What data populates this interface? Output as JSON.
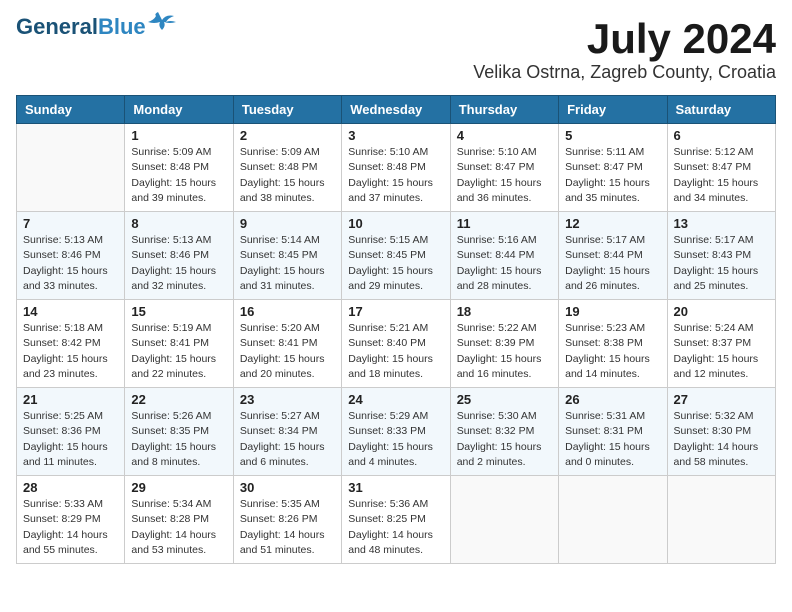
{
  "header": {
    "logo_line1": "General",
    "logo_line2": "Blue",
    "month": "July 2024",
    "location": "Velika Ostrna, Zagreb County, Croatia"
  },
  "weekdays": [
    "Sunday",
    "Monday",
    "Tuesday",
    "Wednesday",
    "Thursday",
    "Friday",
    "Saturday"
  ],
  "weeks": [
    [
      {
        "day": "",
        "sunrise": "",
        "sunset": "",
        "daylight": ""
      },
      {
        "day": "1",
        "sunrise": "Sunrise: 5:09 AM",
        "sunset": "Sunset: 8:48 PM",
        "daylight": "Daylight: 15 hours and 39 minutes."
      },
      {
        "day": "2",
        "sunrise": "Sunrise: 5:09 AM",
        "sunset": "Sunset: 8:48 PM",
        "daylight": "Daylight: 15 hours and 38 minutes."
      },
      {
        "day": "3",
        "sunrise": "Sunrise: 5:10 AM",
        "sunset": "Sunset: 8:48 PM",
        "daylight": "Daylight: 15 hours and 37 minutes."
      },
      {
        "day": "4",
        "sunrise": "Sunrise: 5:10 AM",
        "sunset": "Sunset: 8:47 PM",
        "daylight": "Daylight: 15 hours and 36 minutes."
      },
      {
        "day": "5",
        "sunrise": "Sunrise: 5:11 AM",
        "sunset": "Sunset: 8:47 PM",
        "daylight": "Daylight: 15 hours and 35 minutes."
      },
      {
        "day": "6",
        "sunrise": "Sunrise: 5:12 AM",
        "sunset": "Sunset: 8:47 PM",
        "daylight": "Daylight: 15 hours and 34 minutes."
      }
    ],
    [
      {
        "day": "7",
        "sunrise": "Sunrise: 5:13 AM",
        "sunset": "Sunset: 8:46 PM",
        "daylight": "Daylight: 15 hours and 33 minutes."
      },
      {
        "day": "8",
        "sunrise": "Sunrise: 5:13 AM",
        "sunset": "Sunset: 8:46 PM",
        "daylight": "Daylight: 15 hours and 32 minutes."
      },
      {
        "day": "9",
        "sunrise": "Sunrise: 5:14 AM",
        "sunset": "Sunset: 8:45 PM",
        "daylight": "Daylight: 15 hours and 31 minutes."
      },
      {
        "day": "10",
        "sunrise": "Sunrise: 5:15 AM",
        "sunset": "Sunset: 8:45 PM",
        "daylight": "Daylight: 15 hours and 29 minutes."
      },
      {
        "day": "11",
        "sunrise": "Sunrise: 5:16 AM",
        "sunset": "Sunset: 8:44 PM",
        "daylight": "Daylight: 15 hours and 28 minutes."
      },
      {
        "day": "12",
        "sunrise": "Sunrise: 5:17 AM",
        "sunset": "Sunset: 8:44 PM",
        "daylight": "Daylight: 15 hours and 26 minutes."
      },
      {
        "day": "13",
        "sunrise": "Sunrise: 5:17 AM",
        "sunset": "Sunset: 8:43 PM",
        "daylight": "Daylight: 15 hours and 25 minutes."
      }
    ],
    [
      {
        "day": "14",
        "sunrise": "Sunrise: 5:18 AM",
        "sunset": "Sunset: 8:42 PM",
        "daylight": "Daylight: 15 hours and 23 minutes."
      },
      {
        "day": "15",
        "sunrise": "Sunrise: 5:19 AM",
        "sunset": "Sunset: 8:41 PM",
        "daylight": "Daylight: 15 hours and 22 minutes."
      },
      {
        "day": "16",
        "sunrise": "Sunrise: 5:20 AM",
        "sunset": "Sunset: 8:41 PM",
        "daylight": "Daylight: 15 hours and 20 minutes."
      },
      {
        "day": "17",
        "sunrise": "Sunrise: 5:21 AM",
        "sunset": "Sunset: 8:40 PM",
        "daylight": "Daylight: 15 hours and 18 minutes."
      },
      {
        "day": "18",
        "sunrise": "Sunrise: 5:22 AM",
        "sunset": "Sunset: 8:39 PM",
        "daylight": "Daylight: 15 hours and 16 minutes."
      },
      {
        "day": "19",
        "sunrise": "Sunrise: 5:23 AM",
        "sunset": "Sunset: 8:38 PM",
        "daylight": "Daylight: 15 hours and 14 minutes."
      },
      {
        "day": "20",
        "sunrise": "Sunrise: 5:24 AM",
        "sunset": "Sunset: 8:37 PM",
        "daylight": "Daylight: 15 hours and 12 minutes."
      }
    ],
    [
      {
        "day": "21",
        "sunrise": "Sunrise: 5:25 AM",
        "sunset": "Sunset: 8:36 PM",
        "daylight": "Daylight: 15 hours and 11 minutes."
      },
      {
        "day": "22",
        "sunrise": "Sunrise: 5:26 AM",
        "sunset": "Sunset: 8:35 PM",
        "daylight": "Daylight: 15 hours and 8 minutes."
      },
      {
        "day": "23",
        "sunrise": "Sunrise: 5:27 AM",
        "sunset": "Sunset: 8:34 PM",
        "daylight": "Daylight: 15 hours and 6 minutes."
      },
      {
        "day": "24",
        "sunrise": "Sunrise: 5:29 AM",
        "sunset": "Sunset: 8:33 PM",
        "daylight": "Daylight: 15 hours and 4 minutes."
      },
      {
        "day": "25",
        "sunrise": "Sunrise: 5:30 AM",
        "sunset": "Sunset: 8:32 PM",
        "daylight": "Daylight: 15 hours and 2 minutes."
      },
      {
        "day": "26",
        "sunrise": "Sunrise: 5:31 AM",
        "sunset": "Sunset: 8:31 PM",
        "daylight": "Daylight: 15 hours and 0 minutes."
      },
      {
        "day": "27",
        "sunrise": "Sunrise: 5:32 AM",
        "sunset": "Sunset: 8:30 PM",
        "daylight": "Daylight: 14 hours and 58 minutes."
      }
    ],
    [
      {
        "day": "28",
        "sunrise": "Sunrise: 5:33 AM",
        "sunset": "Sunset: 8:29 PM",
        "daylight": "Daylight: 14 hours and 55 minutes."
      },
      {
        "day": "29",
        "sunrise": "Sunrise: 5:34 AM",
        "sunset": "Sunset: 8:28 PM",
        "daylight": "Daylight: 14 hours and 53 minutes."
      },
      {
        "day": "30",
        "sunrise": "Sunrise: 5:35 AM",
        "sunset": "Sunset: 8:26 PM",
        "daylight": "Daylight: 14 hours and 51 minutes."
      },
      {
        "day": "31",
        "sunrise": "Sunrise: 5:36 AM",
        "sunset": "Sunset: 8:25 PM",
        "daylight": "Daylight: 14 hours and 48 minutes."
      },
      {
        "day": "",
        "sunrise": "",
        "sunset": "",
        "daylight": ""
      },
      {
        "day": "",
        "sunrise": "",
        "sunset": "",
        "daylight": ""
      },
      {
        "day": "",
        "sunrise": "",
        "sunset": "",
        "daylight": ""
      }
    ]
  ]
}
